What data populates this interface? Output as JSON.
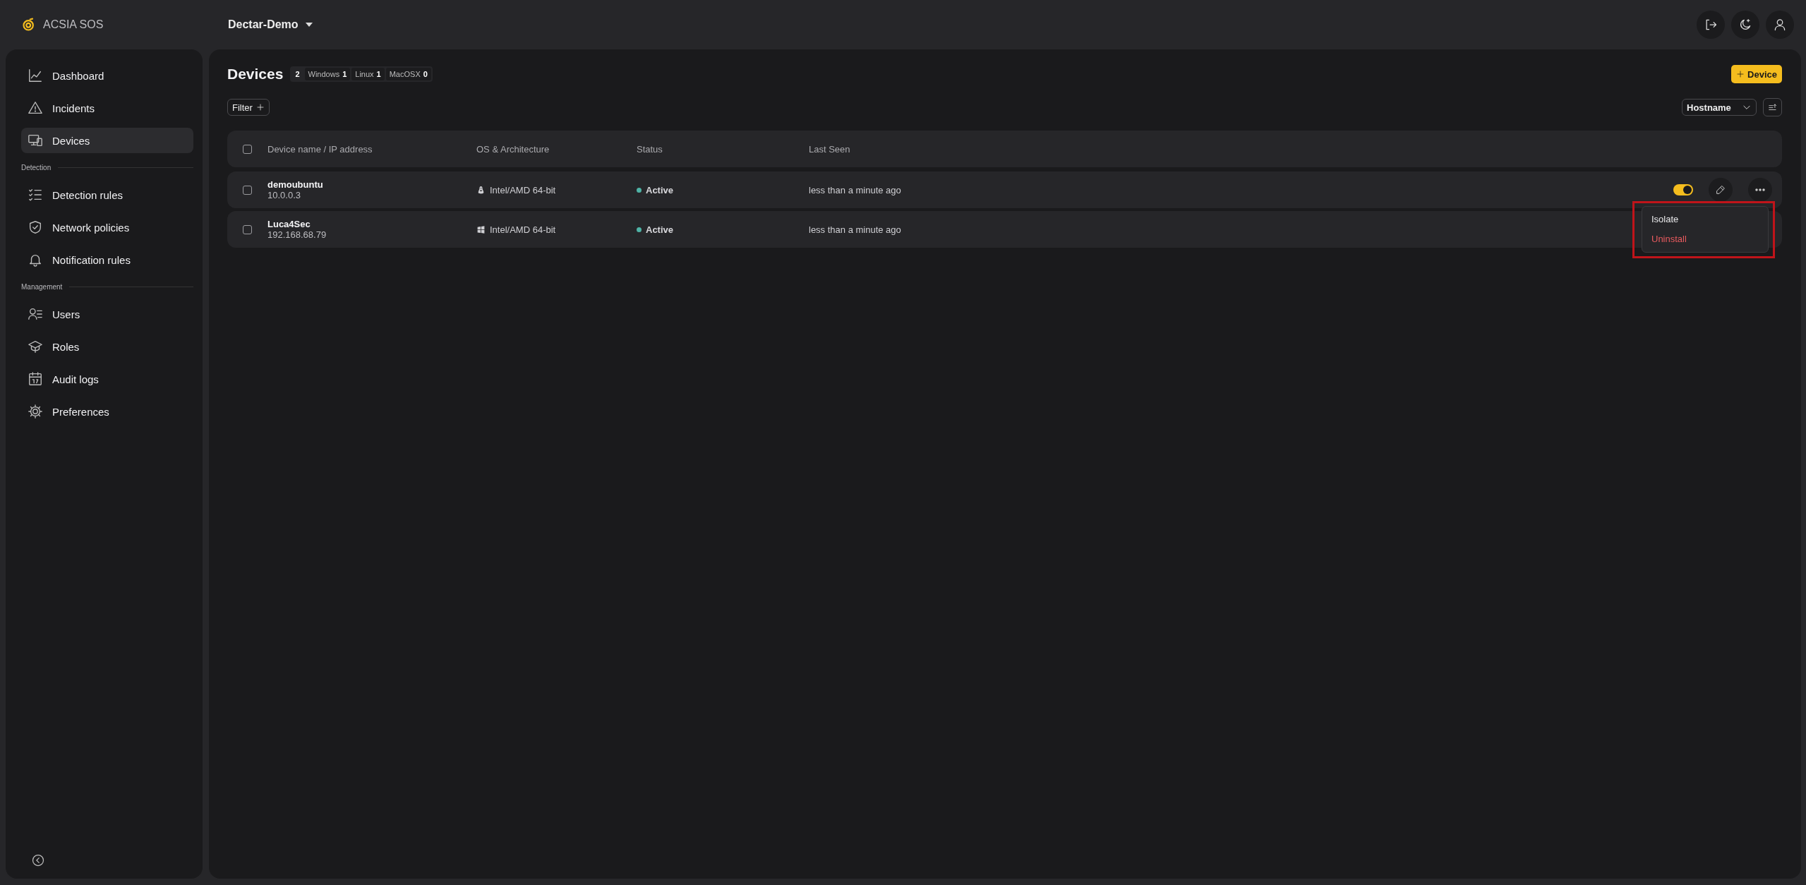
{
  "app": {
    "name": "ACSIA SOS"
  },
  "org_selector": {
    "label": "Dectar-Demo"
  },
  "sidebar": {
    "sections": [
      {
        "items": [
          {
            "label": "Dashboard",
            "selected": false
          },
          {
            "label": "Incidents",
            "selected": false
          },
          {
            "label": "Devices",
            "selected": true
          }
        ]
      },
      {
        "title": "Detection",
        "items": [
          {
            "label": "Detection rules",
            "selected": false
          },
          {
            "label": "Network policies",
            "selected": false
          },
          {
            "label": "Notification rules",
            "selected": false
          }
        ]
      },
      {
        "title": "Management",
        "items": [
          {
            "label": "Users",
            "selected": false
          },
          {
            "label": "Roles",
            "selected": false
          },
          {
            "label": "Audit logs",
            "selected": false
          },
          {
            "label": "Preferences",
            "selected": false
          }
        ]
      }
    ]
  },
  "page": {
    "title": "Devices",
    "total": "2",
    "counts": [
      {
        "label": "Windows",
        "count": "1"
      },
      {
        "label": "Linux",
        "count": "1"
      },
      {
        "label": "MacOSX",
        "count": "0"
      }
    ],
    "add_button": "Device",
    "filter_button": "Filter",
    "sort_select": {
      "value": "Hostname"
    }
  },
  "table": {
    "columns": [
      "Device name / IP address",
      "OS & Architecture",
      "Status",
      "Last Seen"
    ],
    "all_checked": false,
    "rows": [
      {
        "name": "demoubuntu",
        "ip": "10.0.0.3",
        "arch": "Intel/AMD 64-bit",
        "status": "Active",
        "last_seen": "less than a minute ago",
        "checked": false,
        "toggle": {
          "on": true
        }
      },
      {
        "name": "Luca4Sec",
        "ip": "192.168.68.79",
        "arch": "Intel/AMD 64-bit",
        "status": "Active",
        "last_seen": "less than a minute ago",
        "checked": false
      }
    ]
  },
  "context_menu": {
    "highlighted": true,
    "items": [
      {
        "label": "Isolate",
        "kind": "normal"
      },
      {
        "label": "Uninstall",
        "kind": "danger"
      }
    ]
  }
}
